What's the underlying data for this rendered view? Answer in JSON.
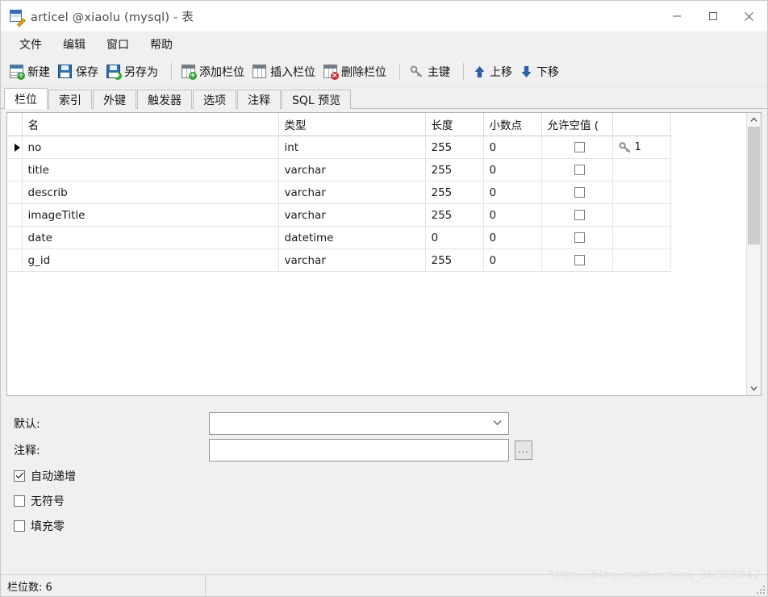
{
  "window": {
    "title": "articel @xiaolu (mysql) - 表",
    "icon": "table-edit-icon",
    "minimize_label": "—",
    "maximize_label": "□",
    "close_label": "✕"
  },
  "menubar": {
    "items": [
      {
        "label": "文件"
      },
      {
        "label": "编辑"
      },
      {
        "label": "窗口"
      },
      {
        "label": "帮助"
      }
    ]
  },
  "toolbar": {
    "groups": [
      {
        "buttons": [
          {
            "label": "新建",
            "icon": "new-table-icon"
          },
          {
            "label": "保存",
            "icon": "save-icon"
          },
          {
            "label": "另存为",
            "icon": "save-as-icon"
          }
        ]
      },
      {
        "buttons": [
          {
            "label": "添加栏位",
            "icon": "add-field-icon"
          },
          {
            "label": "插入栏位",
            "icon": "insert-field-icon"
          },
          {
            "label": "删除栏位",
            "icon": "delete-field-icon"
          }
        ]
      },
      {
        "buttons": [
          {
            "label": "主键",
            "icon": "primary-key-icon"
          }
        ]
      },
      {
        "buttons": [
          {
            "label": "上移",
            "icon": "arrow-up-icon"
          },
          {
            "label": "下移",
            "icon": "arrow-down-icon"
          }
        ]
      }
    ]
  },
  "tabs": {
    "items": [
      {
        "label": "栏位",
        "active": true
      },
      {
        "label": "索引",
        "active": false
      },
      {
        "label": "外键",
        "active": false
      },
      {
        "label": "触发器",
        "active": false
      },
      {
        "label": "选项",
        "active": false
      },
      {
        "label": "注释",
        "active": false
      },
      {
        "label": "SQL 预览",
        "active": false
      }
    ]
  },
  "grid": {
    "columns": [
      {
        "label": "名"
      },
      {
        "label": "类型"
      },
      {
        "label": "长度"
      },
      {
        "label": "小数点"
      },
      {
        "label": "允许空值 ("
      },
      {
        "label": ""
      }
    ],
    "rows": [
      {
        "selected": true,
        "name": "no",
        "type": "int",
        "length": "255",
        "decimals": "0",
        "not_null": false,
        "key": "1"
      },
      {
        "selected": false,
        "name": "title",
        "type": "varchar",
        "length": "255",
        "decimals": "0",
        "not_null": false,
        "key": ""
      },
      {
        "selected": false,
        "name": "describ",
        "type": "varchar",
        "length": "255",
        "decimals": "0",
        "not_null": false,
        "key": ""
      },
      {
        "selected": false,
        "name": "imageTitle",
        "type": "varchar",
        "length": "255",
        "decimals": "0",
        "not_null": false,
        "key": ""
      },
      {
        "selected": false,
        "name": "date",
        "type": "datetime",
        "length": "0",
        "decimals": "0",
        "not_null": false,
        "key": ""
      },
      {
        "selected": false,
        "name": "g_id",
        "type": "varchar",
        "length": "255",
        "decimals": "0",
        "not_null": false,
        "key": ""
      }
    ]
  },
  "properties": {
    "default": {
      "label": "默认:",
      "value": "",
      "placeholder": ""
    },
    "comment": {
      "label": "注释:",
      "value": "",
      "placeholder": "",
      "browse_label": "..."
    },
    "checkboxes": [
      {
        "label": "自动递增",
        "checked": true
      },
      {
        "label": "无符号",
        "checked": false
      },
      {
        "label": "填充零",
        "checked": false
      }
    ]
  },
  "statusbar": {
    "field_count": "栏位数: 6"
  },
  "watermark": {
    "text": "https://blog.csdn.net/qq_36903042"
  },
  "colors": {
    "accent": "#2f6fad",
    "window_bg": "#f0f0f0",
    "grid_bg": "#ffffff",
    "key_green": "#2fa12f",
    "delete_red": "#cc2222",
    "arrow_blue": "#2f5fa8"
  }
}
